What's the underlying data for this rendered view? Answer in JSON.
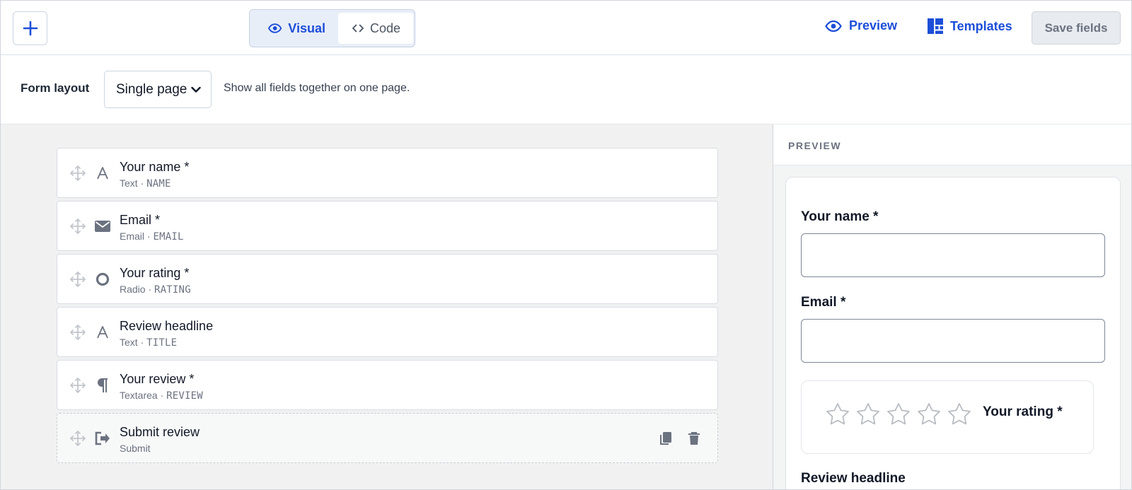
{
  "toolbar": {
    "add_label": "+",
    "view_modes": [
      {
        "label": "Visual",
        "active": true
      },
      {
        "label": "Code",
        "active": false
      }
    ],
    "preview_label": "Preview",
    "templates_label": "Templates",
    "save_label": "Save fields",
    "accent_color": "#1d4ed8"
  },
  "layout": {
    "label": "Form layout",
    "selected": "Single page",
    "description": "Show all fields together on one page."
  },
  "fields": [
    {
      "title": "Your name *",
      "type": "Text",
      "key": "NAME",
      "icon": "text-a-icon"
    },
    {
      "title": "Email *",
      "type": "Email",
      "key": "EMAIL",
      "icon": "envelope-icon"
    },
    {
      "title": "Your rating *",
      "type": "Radio",
      "key": "RATING",
      "icon": "radio-circle-icon"
    },
    {
      "title": "Review headline",
      "type": "Text",
      "key": "TITLE",
      "icon": "text-a-icon"
    },
    {
      "title": "Your review *",
      "type": "Textarea",
      "key": "REVIEW",
      "icon": "pilcrow-icon"
    },
    {
      "title": "Submit review",
      "type": "Submit",
      "key": "",
      "icon": "submit-arrow-icon"
    }
  ],
  "preview": {
    "heading": "PREVIEW",
    "name_label": "Your name *",
    "email_label": "Email *",
    "rating_label": "Your rating *",
    "rating_stars": 5,
    "headline_label": "Review headline"
  }
}
